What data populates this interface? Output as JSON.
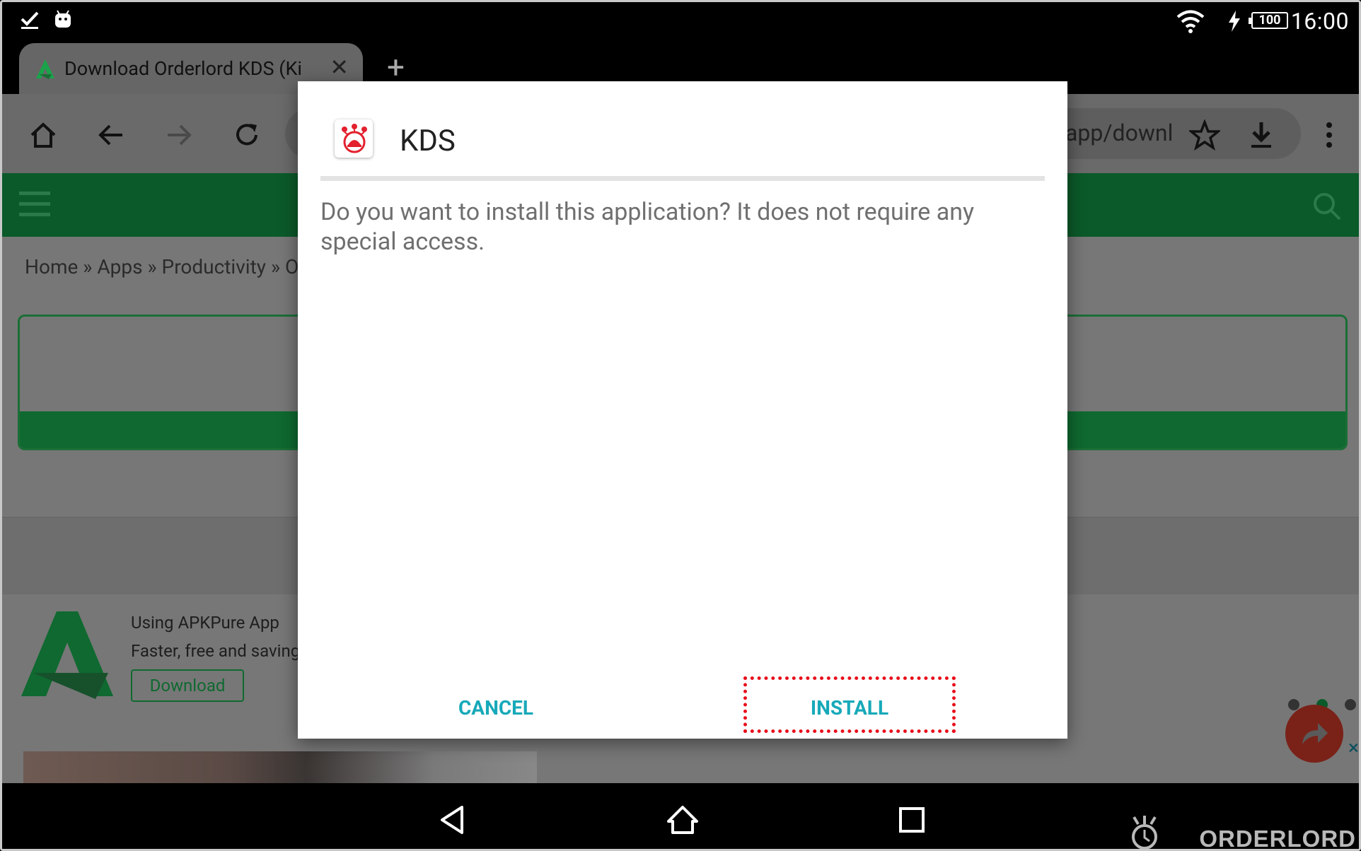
{
  "status_bar": {
    "time": "16:00",
    "battery_level": "100",
    "icons": [
      "checkmark-download-icon",
      "android-icon",
      "wifi-icon",
      "charging-bolt-icon",
      "battery-icon"
    ]
  },
  "browser": {
    "tab": {
      "title": "Download Orderlord KDS (Ki",
      "favicon": "apkpure-favicon-icon",
      "close_icon": "close-icon"
    },
    "new_tab_label": "+",
    "toolbar": {
      "icons": [
        "home-icon",
        "back-arrow-icon",
        "forward-arrow-icon",
        "reload-icon",
        "star-icon",
        "download-icon",
        "overflow-menu-icon"
      ],
      "url_fragment": "app/downl"
    },
    "page": {
      "breadcrumb": "Home » Apps » Productivity » O",
      "promo": {
        "line1": "Using APKPure App",
        "line2": "Faster, free and saving",
        "download_label": "Download"
      },
      "ad_close": "×"
    }
  },
  "dialog": {
    "app_name": "KDS",
    "message": "Do you want to install this application? It does not require any special access.",
    "cancel_label": "CANCEL",
    "install_label": "INSTALL"
  },
  "nav_bar": {
    "icons": [
      "back-triangle-icon",
      "home-outline-icon",
      "recents-square-icon"
    ]
  },
  "watermark": {
    "text": "ORDERLORD"
  },
  "colors": {
    "accent_teal": "#17a9b9",
    "highlight_red": "#e8101c",
    "site_green": "#0f6930"
  }
}
